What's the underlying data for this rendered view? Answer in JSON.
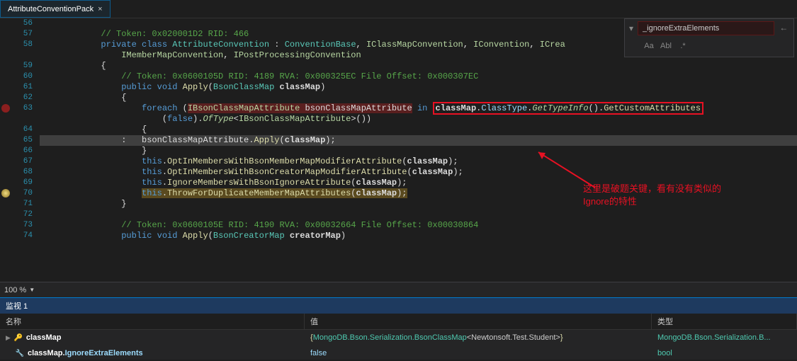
{
  "tab": {
    "title": "AttributeConventionPack",
    "close": "×"
  },
  "search": {
    "value": "_ignoreExtraElements",
    "chevron_label": "expand",
    "opt_case": "Aa",
    "opt_word": "Abl",
    "opt_regex": ".*"
  },
  "zoom": {
    "level": "100 %"
  },
  "code_lines": [
    {
      "num": 56
    },
    {
      "num": 57,
      "comment": "// Token: 0x020001D2 RID: 466"
    },
    {
      "num": 58,
      "kw_private": "private",
      "kw_class": "class",
      "type1": "AttributeConvention",
      "type2": "ConventionBase",
      "type3": "IClassMapConvention",
      "type4": "IConvention",
      "type5": "ICrea"
    },
    {
      "num": "",
      "type6": "IMemberMapConvention",
      "type7": "IPostProcessingConvention"
    },
    {
      "num": 59,
      "brace": "{"
    },
    {
      "num": 60,
      "comment": "// Token: 0x0600105D RID: 4189 RVA: 0x000325EC File Offset: 0x000307EC"
    },
    {
      "num": 61,
      "kw_public": "public",
      "kw_void": "void",
      "method": "Apply",
      "param_type": "BsonClassMap",
      "param_name": "classMap"
    },
    {
      "num": 62,
      "brace": "{"
    },
    {
      "num": 63,
      "kw_foreach": "foreach",
      "type8": "IBsonClassMapAttribute",
      "var1": "bsonClassMapAttribute",
      "kw_in": "in",
      "var2": "classMap",
      "prop1": "ClassType",
      "it1": "GetTypeInfo",
      "method2": "GetCustomAttributes"
    },
    {
      "num": "",
      "val_false": "false",
      "it2": "OfType",
      "type9": "IBsonClassMapAttribute"
    },
    {
      "num": 64,
      "brace": "{"
    },
    {
      "num": 65,
      "var3": "bsonClassMapAttribute",
      "method3": "Apply",
      "arg": "classMap"
    },
    {
      "num": 66,
      "brace": "}"
    },
    {
      "num": 67,
      "kw_this": "this",
      "method4": "OptInMembersWithBsonMemberMapModifierAttribute",
      "arg2": "classMap"
    },
    {
      "num": 68,
      "kw_this2": "this",
      "method5": "OptInMembersWithBsonCreatorMapModifierAttribute",
      "arg3": "classMap"
    },
    {
      "num": 69,
      "kw_this3": "this",
      "method6": "IgnoreMembersWithBsonIgnoreAttribute",
      "arg4": "classMap"
    },
    {
      "num": 70,
      "kw_this4": "this",
      "method7": "ThrowForDuplicateMemberMapAttributes",
      "arg5": "classMap"
    },
    {
      "num": 71,
      "brace": "}"
    },
    {
      "num": 72
    },
    {
      "num": 73,
      "comment": "// Token: 0x0600105E RID: 4190 RVA: 0x00032664 File Offset: 0x00030864"
    },
    {
      "num": 74,
      "kw_public": "public",
      "kw_void": "void",
      "method": "Apply",
      "param_type": "BsonCreatorMap",
      "param_name": "creatorMap"
    }
  ],
  "watch": {
    "title": "监视 1",
    "headers": {
      "name": "名称",
      "value": "值",
      "type": "类型"
    },
    "rows": [
      {
        "icon": "▶",
        "iconglyph": "🔑",
        "name": "classMap",
        "value_pre": "{",
        "value_type": "MongoDB.Bson.Serialization.BsonClassMap",
        "value_inner": "<Newtonsoft.Test.Student>",
        "value_post": "}",
        "type": "MongoDB.Bson.Serialization.B..."
      },
      {
        "icon": "",
        "iconglyph": "🔧",
        "name_pre": "classMap.",
        "name_prop": "IgnoreExtraElements",
        "value": "false",
        "type": "bool"
      }
    ]
  },
  "annotation": {
    "line1": "这里是破题关键，看有没有类似的",
    "line2": "Ignore的特性"
  }
}
